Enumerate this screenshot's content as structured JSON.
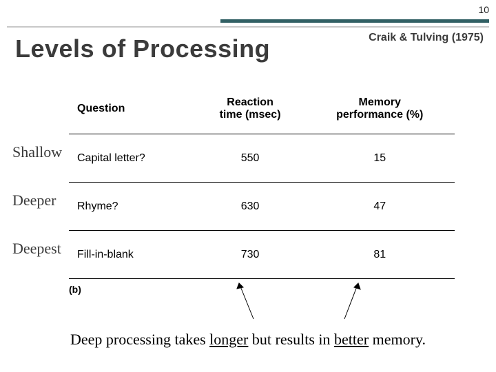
{
  "page_number": "10",
  "title": "Levels of Processing",
  "citation": "Craik & Tulving (1975)",
  "headers": {
    "question": "Question",
    "rt": "Reaction\ntime (msec)",
    "mem": "Memory\nperformance (%)"
  },
  "depth_labels": [
    "Shallow",
    "Deeper",
    "Deepest"
  ],
  "rows": [
    {
      "question": "Capital letter?",
      "rt": "550",
      "mem": "15"
    },
    {
      "question": "Rhyme?",
      "rt": "630",
      "mem": "47"
    },
    {
      "question": "Fill-in-blank",
      "rt": "730",
      "mem": "81"
    }
  ],
  "figure_label": "(b)",
  "conclusion": {
    "p1": "Deep processing takes ",
    "u1": "longer",
    "p2": " but results in ",
    "u2": "better",
    "p3": " memory."
  },
  "chart_data": {
    "type": "table",
    "title": "Levels of Processing — Craik & Tulving (1975)",
    "columns": [
      "Question",
      "Reaction time (msec)",
      "Memory performance (%)"
    ],
    "row_labels": [
      "Shallow",
      "Deeper",
      "Deepest"
    ],
    "rows": [
      [
        "Capital letter?",
        550,
        15
      ],
      [
        "Rhyme?",
        630,
        47
      ],
      [
        "Fill-in-blank",
        730,
        81
      ]
    ]
  }
}
